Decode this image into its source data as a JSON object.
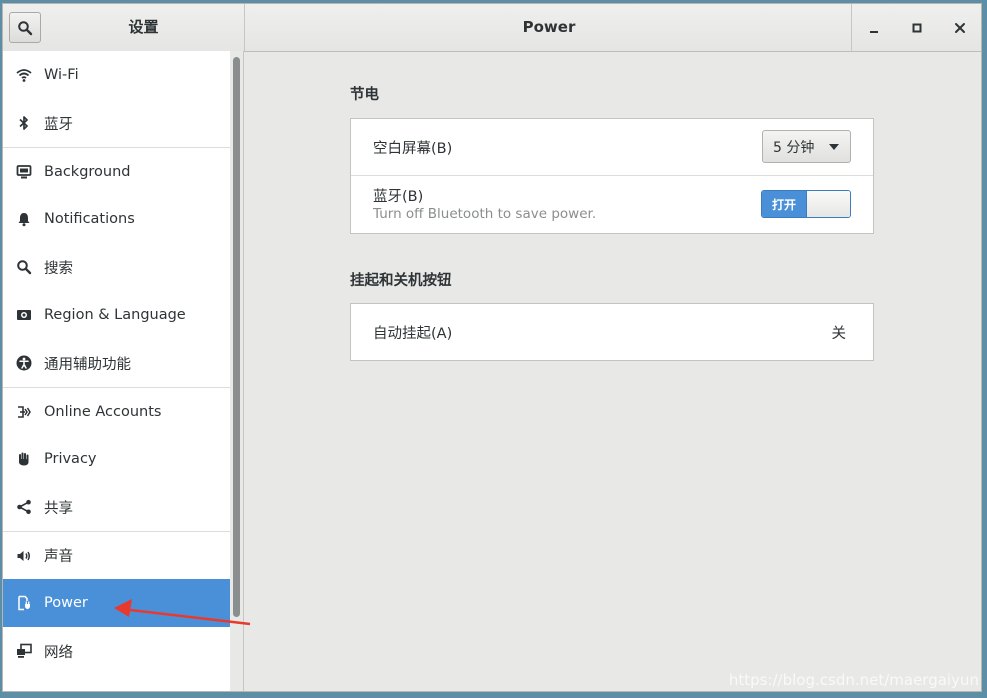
{
  "header": {
    "sidebar_title": "设置",
    "page_title": "Power"
  },
  "sidebar": {
    "items": [
      {
        "label": "Wi-Fi",
        "icon": "wifi-icon"
      },
      {
        "label": "蓝牙",
        "icon": "bluetooth-icon"
      },
      {
        "label": "Background",
        "icon": "background-icon"
      },
      {
        "label": "Notifications",
        "icon": "bell-icon"
      },
      {
        "label": "搜索",
        "icon": "search-icon"
      },
      {
        "label": "Region & Language",
        "icon": "region-icon"
      },
      {
        "label": "通用辅助功能",
        "icon": "accessibility-icon"
      },
      {
        "label": "Online Accounts",
        "icon": "online-accounts-icon"
      },
      {
        "label": "Privacy",
        "icon": "hand-icon"
      },
      {
        "label": "共享",
        "icon": "share-icon"
      },
      {
        "label": "声音",
        "icon": "speaker-icon"
      },
      {
        "label": "Power",
        "icon": "power-plug-icon",
        "selected": true
      },
      {
        "label": "网络",
        "icon": "network-icon"
      }
    ]
  },
  "power_saving": {
    "title": "节电",
    "blank_screen_label": "空白屏幕(B)",
    "blank_screen_value": "5 分钟",
    "bluetooth_label": "蓝牙(B)",
    "bluetooth_sub": "Turn off Bluetooth to save power.",
    "bluetooth_switch": "打开"
  },
  "suspend": {
    "title": "挂起和关机按钮",
    "auto_suspend_label": "自动挂起(A)",
    "auto_suspend_value": "关"
  },
  "watermark": "https://blog.csdn.net/maergaiyun",
  "colors": {
    "accent": "#4a90d9",
    "desktop": "#5d8ea6",
    "annotation_arrow": "#e8392f"
  }
}
